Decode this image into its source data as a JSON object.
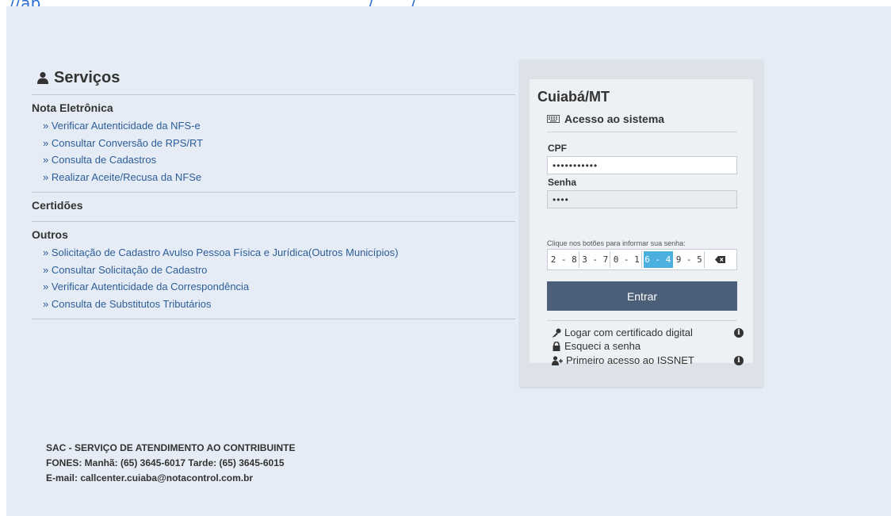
{
  "top_url": "//ap., ..................................................,......../......./.......... ...",
  "services": {
    "title": "Serviços",
    "sections": [
      {
        "title": "Nota Eletrônica",
        "items": [
          "Verificar Autenticidade da NFS-e",
          "Consultar Conversão de RPS/RT",
          "Consulta de Cadastros",
          "Realizar Aceite/Recusa da NFSe"
        ]
      },
      {
        "title": "Certidões",
        "items": []
      },
      {
        "title": "Outros",
        "items": [
          "Solicitação de Cadastro Avulso Pessoa Física e Jurídica(Outros Municípios)",
          "Consultar Solicitação de Cadastro",
          "Verificar Autenticidade da Correspondência",
          "Consulta de Substitutos Tributários"
        ]
      }
    ]
  },
  "login": {
    "city": "Cuiabá/MT",
    "access_title": "Acesso ao sistema",
    "cpf_label": "CPF",
    "cpf_value": "•••••••••••",
    "password_label": "Senha",
    "password_value": "••••",
    "hint": "Clique nos botões para informar sua senha:",
    "keys": [
      "2 - 8",
      "3 - 7",
      "0 - 1",
      "6 - 4",
      "9 - 5"
    ],
    "active_key_index": 3,
    "submit_label": "Entrar",
    "links": {
      "certificate": "Logar com certificado digital",
      "forgot": "Esqueci a senha",
      "first_access": "Primeiro acesso ao ISSNET"
    }
  },
  "footer": {
    "line1": "SAC - SERVIÇO DE ATENDIMENTO AO CONTRIBUINTE",
    "line2": "FONES: Manhã: (65) 3645-6017 Tarde: (65) 3645-6015",
    "line3": "E-mail: callcenter.cuiaba@notacontrol.com.br"
  },
  "colors": {
    "page_background": "#e6ecf5",
    "link": "#2d5d99",
    "button": "#4c5f78",
    "active_key": "#4bb0e0"
  },
  "icons": [
    "user-icon",
    "keyboard-icon",
    "backspace-icon",
    "key-icon",
    "lock-icon",
    "user-plus-icon",
    "info-icon"
  ]
}
